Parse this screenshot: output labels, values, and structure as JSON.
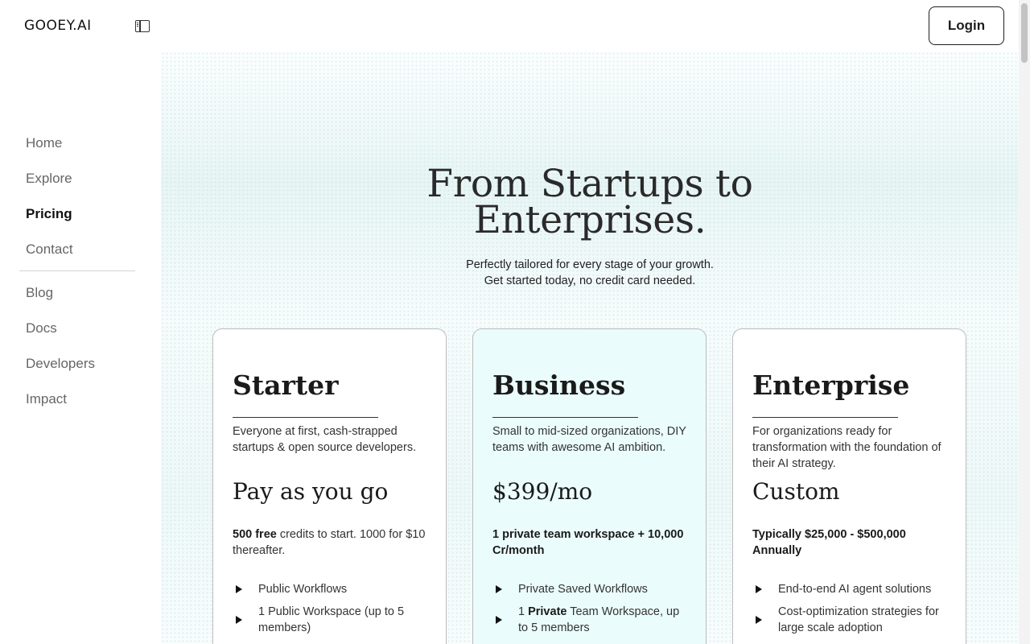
{
  "header": {
    "logo": "GOOEY.AI",
    "login_label": "Login"
  },
  "sidebar": {
    "items": [
      {
        "label": "Home",
        "active": false
      },
      {
        "label": "Explore",
        "active": false
      },
      {
        "label": "Pricing",
        "active": true
      },
      {
        "label": "Contact",
        "active": false
      },
      {
        "label": "Blog",
        "active": false
      },
      {
        "label": "Docs",
        "active": false
      },
      {
        "label": "Developers",
        "active": false
      },
      {
        "label": "Impact",
        "active": false
      }
    ]
  },
  "hero": {
    "title_line1": "From Startups to",
    "title_line2": "Enterprises.",
    "subtitle_line1": "Perfectly tailored for every stage of your growth.",
    "subtitle_line2": "Get started today, no credit card needed."
  },
  "plans": [
    {
      "name": "Starter",
      "description": "Everyone at first, cash-strapped startups & open source developers.",
      "price": "Pay as you go",
      "credits_bold": "500 free",
      "credits_rest": " credits to start. 1000 for $10 thereafter.",
      "features": [
        {
          "text": "Public Workflows"
        },
        {
          "text": "1 Public Workspace (up to 5 members)"
        }
      ]
    },
    {
      "name": "Business",
      "description": "Small to mid-sized organizations, DIY teams with awesome AI ambition.",
      "price": "$399/mo",
      "credits": "1 private team workspace + 10,000 Cr/month",
      "features": [
        {
          "text": "Private Saved Workflows"
        },
        {
          "pre": "1 ",
          "bold": "Private",
          "post": " Team Workspace, up to 5 members"
        }
      ]
    },
    {
      "name": "Enterprise",
      "description": "For organizations ready for transformation with the foundation of their AI strategy.",
      "price": "Custom",
      "credits": "Typically $25,000 - $500,000 Annually",
      "features": [
        {
          "text": "End-to-end AI agent solutions"
        },
        {
          "text": "Cost-optimization strategies for large scale adoption"
        }
      ]
    }
  ],
  "colors": {
    "accent_card": "#ebfcfc",
    "text": "#1e1e1e"
  }
}
